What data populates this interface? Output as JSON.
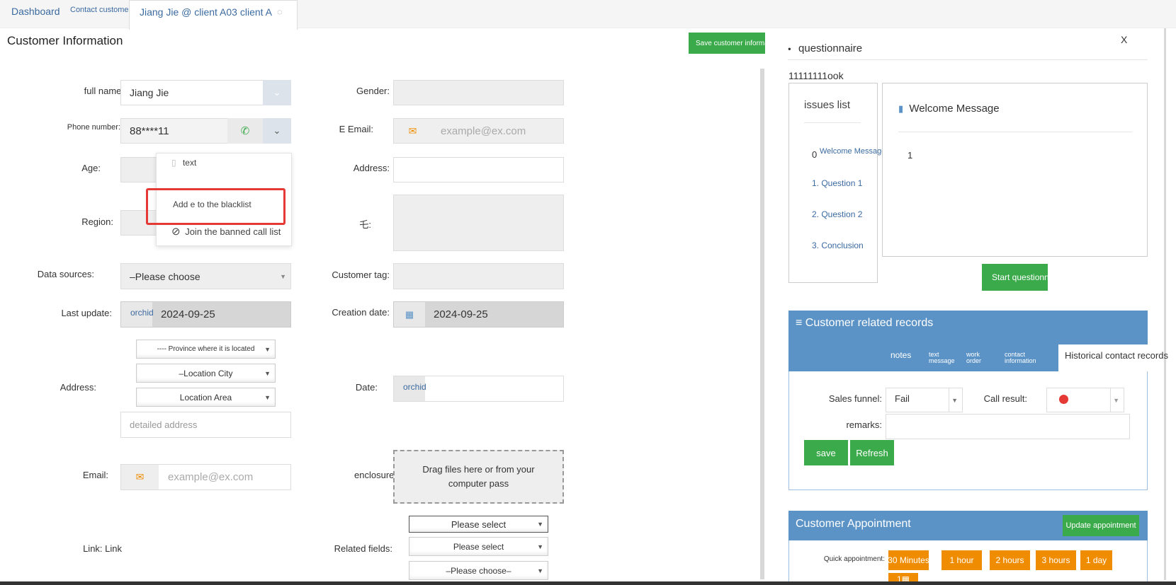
{
  "tabs": {
    "dashboard": "Dashboard",
    "contact": "Contact customers",
    "current": "Jiang Jie @ client A03 client A"
  },
  "page_title": "Customer Information",
  "save_customer_btn": "Save customer information",
  "labels": {
    "full_name": "full name:",
    "phone": "Phone number:",
    "age": "Age:",
    "region": "Region:",
    "data_sources": "Data sources:",
    "last_update": "Last update:",
    "address": "Address:",
    "email": "Email:",
    "link": "Link: Link",
    "gender": "Gender:",
    "e_email": "E Email:",
    "address2": "Address:",
    "mo": "乇:",
    "customer_tag": "Customer tag:",
    "creation_date": "Creation date:",
    "date": "Date:",
    "enclosure": "enclosure:",
    "related_fields": "Related fields:"
  },
  "values": {
    "full_name": "Jiang Jie",
    "phone": "88****11",
    "data_sources": "–Please choose",
    "last_update_prefix": "orchid",
    "last_update": "2024-09-25",
    "creation_date": "2024-09-25",
    "date_prefix": "orchid"
  },
  "placeholders": {
    "email": "example@ex.com",
    "e_email": "example@ex.com",
    "detailed_address": "detailed address"
  },
  "address_selects": {
    "province": "---- Province where it is located",
    "city": "–Location City",
    "area": "Location Area"
  },
  "dropdown": {
    "text": "text",
    "blacklist": "Add e to the blacklist",
    "banned": "Join the banned call list"
  },
  "enclosure_text": "Drag files here or from your computer pass",
  "related_selects": {
    "first": "Please select",
    "second": "Please select",
    "third": "–Please choose–"
  },
  "questionnaire": {
    "title": "questionnaire",
    "close": "X",
    "code": "11111111ook",
    "issues_title": "issues list",
    "item0_num": "0",
    "item0": "Welcome Message",
    "item1": "1. Question 1",
    "item2": "2. Question 2",
    "item3": "3. Conclusion",
    "welcome_title": "Welcome Message",
    "welcome_value": "1",
    "start_btn": "Start questionnaire"
  },
  "records": {
    "title": "≡ Customer related records",
    "tabs": {
      "notes": "notes",
      "text_message": "text message",
      "work_order": "work order",
      "contact_info": "contact information",
      "historical": "Historical contact records"
    },
    "sales_funnel_label": "Sales funnel:",
    "sales_funnel_value": "Fail",
    "call_result_label": "Call result:",
    "remarks_label": "remarks:",
    "save_btn": "save",
    "refresh_btn": "Refresh"
  },
  "appointment": {
    "title": "Customer Appointment",
    "update_btn": "Update appointment",
    "quick_label": "Quick appointment:",
    "options": [
      "30 Minutes",
      "1 hour",
      "2 hours",
      "3 hours",
      "1 day"
    ]
  },
  "colors": {
    "green": "#3aaa4a",
    "orange": "#f08c00",
    "blue": "#5b93c7",
    "highlight": "#e53935"
  }
}
